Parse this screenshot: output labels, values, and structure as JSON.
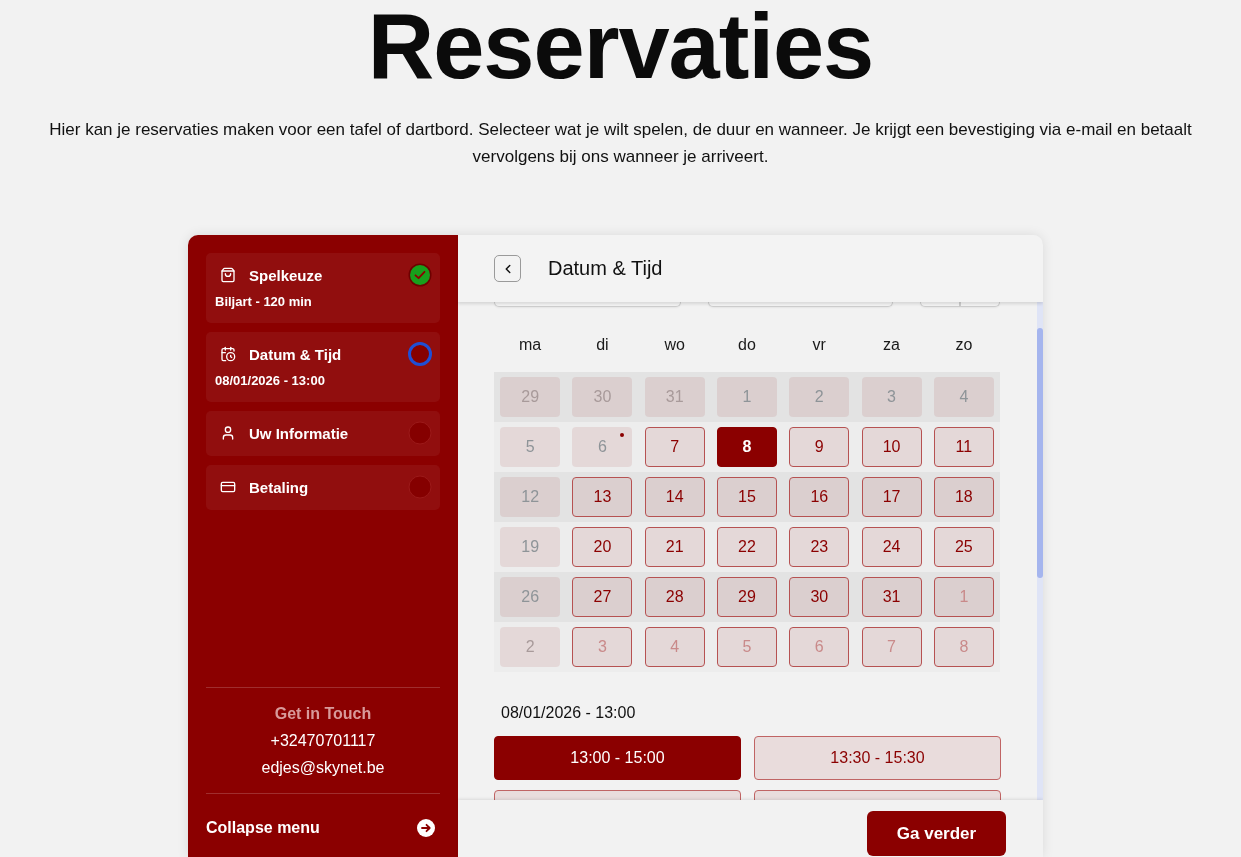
{
  "page": {
    "title": "Reservaties",
    "intro": "Hier kan je reservaties maken voor een tafel of dartbord. Selecteer wat je wilt spelen, de duur en wanneer. Je krijgt een bevestiging via e-mail en betaalt vervolgens bij ons wanneer je arriveert."
  },
  "sidebar": {
    "steps": [
      {
        "kind": "game",
        "title": "Spelkeuze",
        "detail": "Biljart - 120 min",
        "completed": true,
        "active": false
      },
      {
        "kind": "schedule",
        "title": "Datum & Tijd",
        "detail": "08/01/2026 - 13:00",
        "completed": false,
        "active": true
      },
      {
        "kind": "person",
        "title": "Uw Informatie",
        "completed": false,
        "active": false
      },
      {
        "kind": "payment",
        "title": "Betaling",
        "completed": false,
        "active": false
      }
    ],
    "contact": {
      "heading": "Get in Touch",
      "phone": "+32470701117",
      "email": "edjes@skynet.be"
    },
    "collapse_label": "Collapse menu"
  },
  "main": {
    "title": "Datum & Tijd",
    "calendar": {
      "weekdays": [
        "ma",
        "di",
        "wo",
        "do",
        "vr",
        "za",
        "zo"
      ],
      "days": [
        {
          "label": "29",
          "outside": true,
          "disabled": true,
          "selected": false,
          "marked": false
        },
        {
          "label": "30",
          "outside": true,
          "disabled": true,
          "selected": false,
          "marked": false
        },
        {
          "label": "31",
          "outside": true,
          "disabled": true,
          "selected": false,
          "marked": false
        },
        {
          "label": "1",
          "outside": false,
          "disabled": true,
          "selected": false,
          "marked": false
        },
        {
          "label": "2",
          "outside": false,
          "disabled": true,
          "selected": false,
          "marked": false
        },
        {
          "label": "3",
          "outside": false,
          "disabled": true,
          "selected": false,
          "marked": false
        },
        {
          "label": "4",
          "outside": false,
          "disabled": true,
          "selected": false,
          "marked": false
        },
        {
          "label": "5",
          "outside": false,
          "disabled": true,
          "selected": false,
          "marked": false
        },
        {
          "label": "6",
          "outside": false,
          "disabled": true,
          "selected": false,
          "marked": true
        },
        {
          "label": "7",
          "outside": false,
          "disabled": false,
          "selected": false,
          "marked": false
        },
        {
          "label": "8",
          "outside": false,
          "disabled": false,
          "selected": true,
          "marked": false
        },
        {
          "label": "9",
          "outside": false,
          "disabled": false,
          "selected": false,
          "marked": false
        },
        {
          "label": "10",
          "outside": false,
          "disabled": false,
          "selected": false,
          "marked": false
        },
        {
          "label": "11",
          "outside": false,
          "disabled": false,
          "selected": false,
          "marked": false
        },
        {
          "label": "12",
          "outside": false,
          "disabled": true,
          "selected": false,
          "marked": false
        },
        {
          "label": "13",
          "outside": false,
          "disabled": false,
          "selected": false,
          "marked": false
        },
        {
          "label": "14",
          "outside": false,
          "disabled": false,
          "selected": false,
          "marked": false
        },
        {
          "label": "15",
          "outside": false,
          "disabled": false,
          "selected": false,
          "marked": false
        },
        {
          "label": "16",
          "outside": false,
          "disabled": false,
          "selected": false,
          "marked": false
        },
        {
          "label": "17",
          "outside": false,
          "disabled": false,
          "selected": false,
          "marked": false
        },
        {
          "label": "18",
          "outside": false,
          "disabled": false,
          "selected": false,
          "marked": false
        },
        {
          "label": "19",
          "outside": false,
          "disabled": true,
          "selected": false,
          "marked": false
        },
        {
          "label": "20",
          "outside": false,
          "disabled": false,
          "selected": false,
          "marked": false
        },
        {
          "label": "21",
          "outside": false,
          "disabled": false,
          "selected": false,
          "marked": false
        },
        {
          "label": "22",
          "outside": false,
          "disabled": false,
          "selected": false,
          "marked": false
        },
        {
          "label": "23",
          "outside": false,
          "disabled": false,
          "selected": false,
          "marked": false
        },
        {
          "label": "24",
          "outside": false,
          "disabled": false,
          "selected": false,
          "marked": false
        },
        {
          "label": "25",
          "outside": false,
          "disabled": false,
          "selected": false,
          "marked": false
        },
        {
          "label": "26",
          "outside": false,
          "disabled": true,
          "selected": false,
          "marked": false
        },
        {
          "label": "27",
          "outside": false,
          "disabled": false,
          "selected": false,
          "marked": false
        },
        {
          "label": "28",
          "outside": false,
          "disabled": false,
          "selected": false,
          "marked": false
        },
        {
          "label": "29",
          "outside": false,
          "disabled": false,
          "selected": false,
          "marked": false
        },
        {
          "label": "30",
          "outside": false,
          "disabled": false,
          "selected": false,
          "marked": false
        },
        {
          "label": "31",
          "outside": false,
          "disabled": false,
          "selected": false,
          "marked": false
        },
        {
          "label": "1",
          "outside": true,
          "disabled": false,
          "selected": false,
          "marked": false
        },
        {
          "label": "2",
          "outside": true,
          "disabled": true,
          "selected": false,
          "marked": false
        },
        {
          "label": "3",
          "outside": true,
          "disabled": false,
          "selected": false,
          "marked": false
        },
        {
          "label": "4",
          "outside": true,
          "disabled": false,
          "selected": false,
          "marked": false
        },
        {
          "label": "5",
          "outside": true,
          "disabled": false,
          "selected": false,
          "marked": false
        },
        {
          "label": "6",
          "outside": true,
          "disabled": false,
          "selected": false,
          "marked": false
        },
        {
          "label": "7",
          "outside": true,
          "disabled": false,
          "selected": false,
          "marked": false
        },
        {
          "label": "8",
          "outside": true,
          "disabled": false,
          "selected": false,
          "marked": false
        }
      ]
    },
    "selection_label": "08/01/2026 - 13:00",
    "slots": [
      {
        "label": "13:00 - 15:00",
        "selected": true
      },
      {
        "label": "13:30 - 15:30",
        "selected": false
      },
      {
        "selected": false
      },
      {
        "selected": false
      }
    ],
    "next_button": "Ga verder"
  }
}
